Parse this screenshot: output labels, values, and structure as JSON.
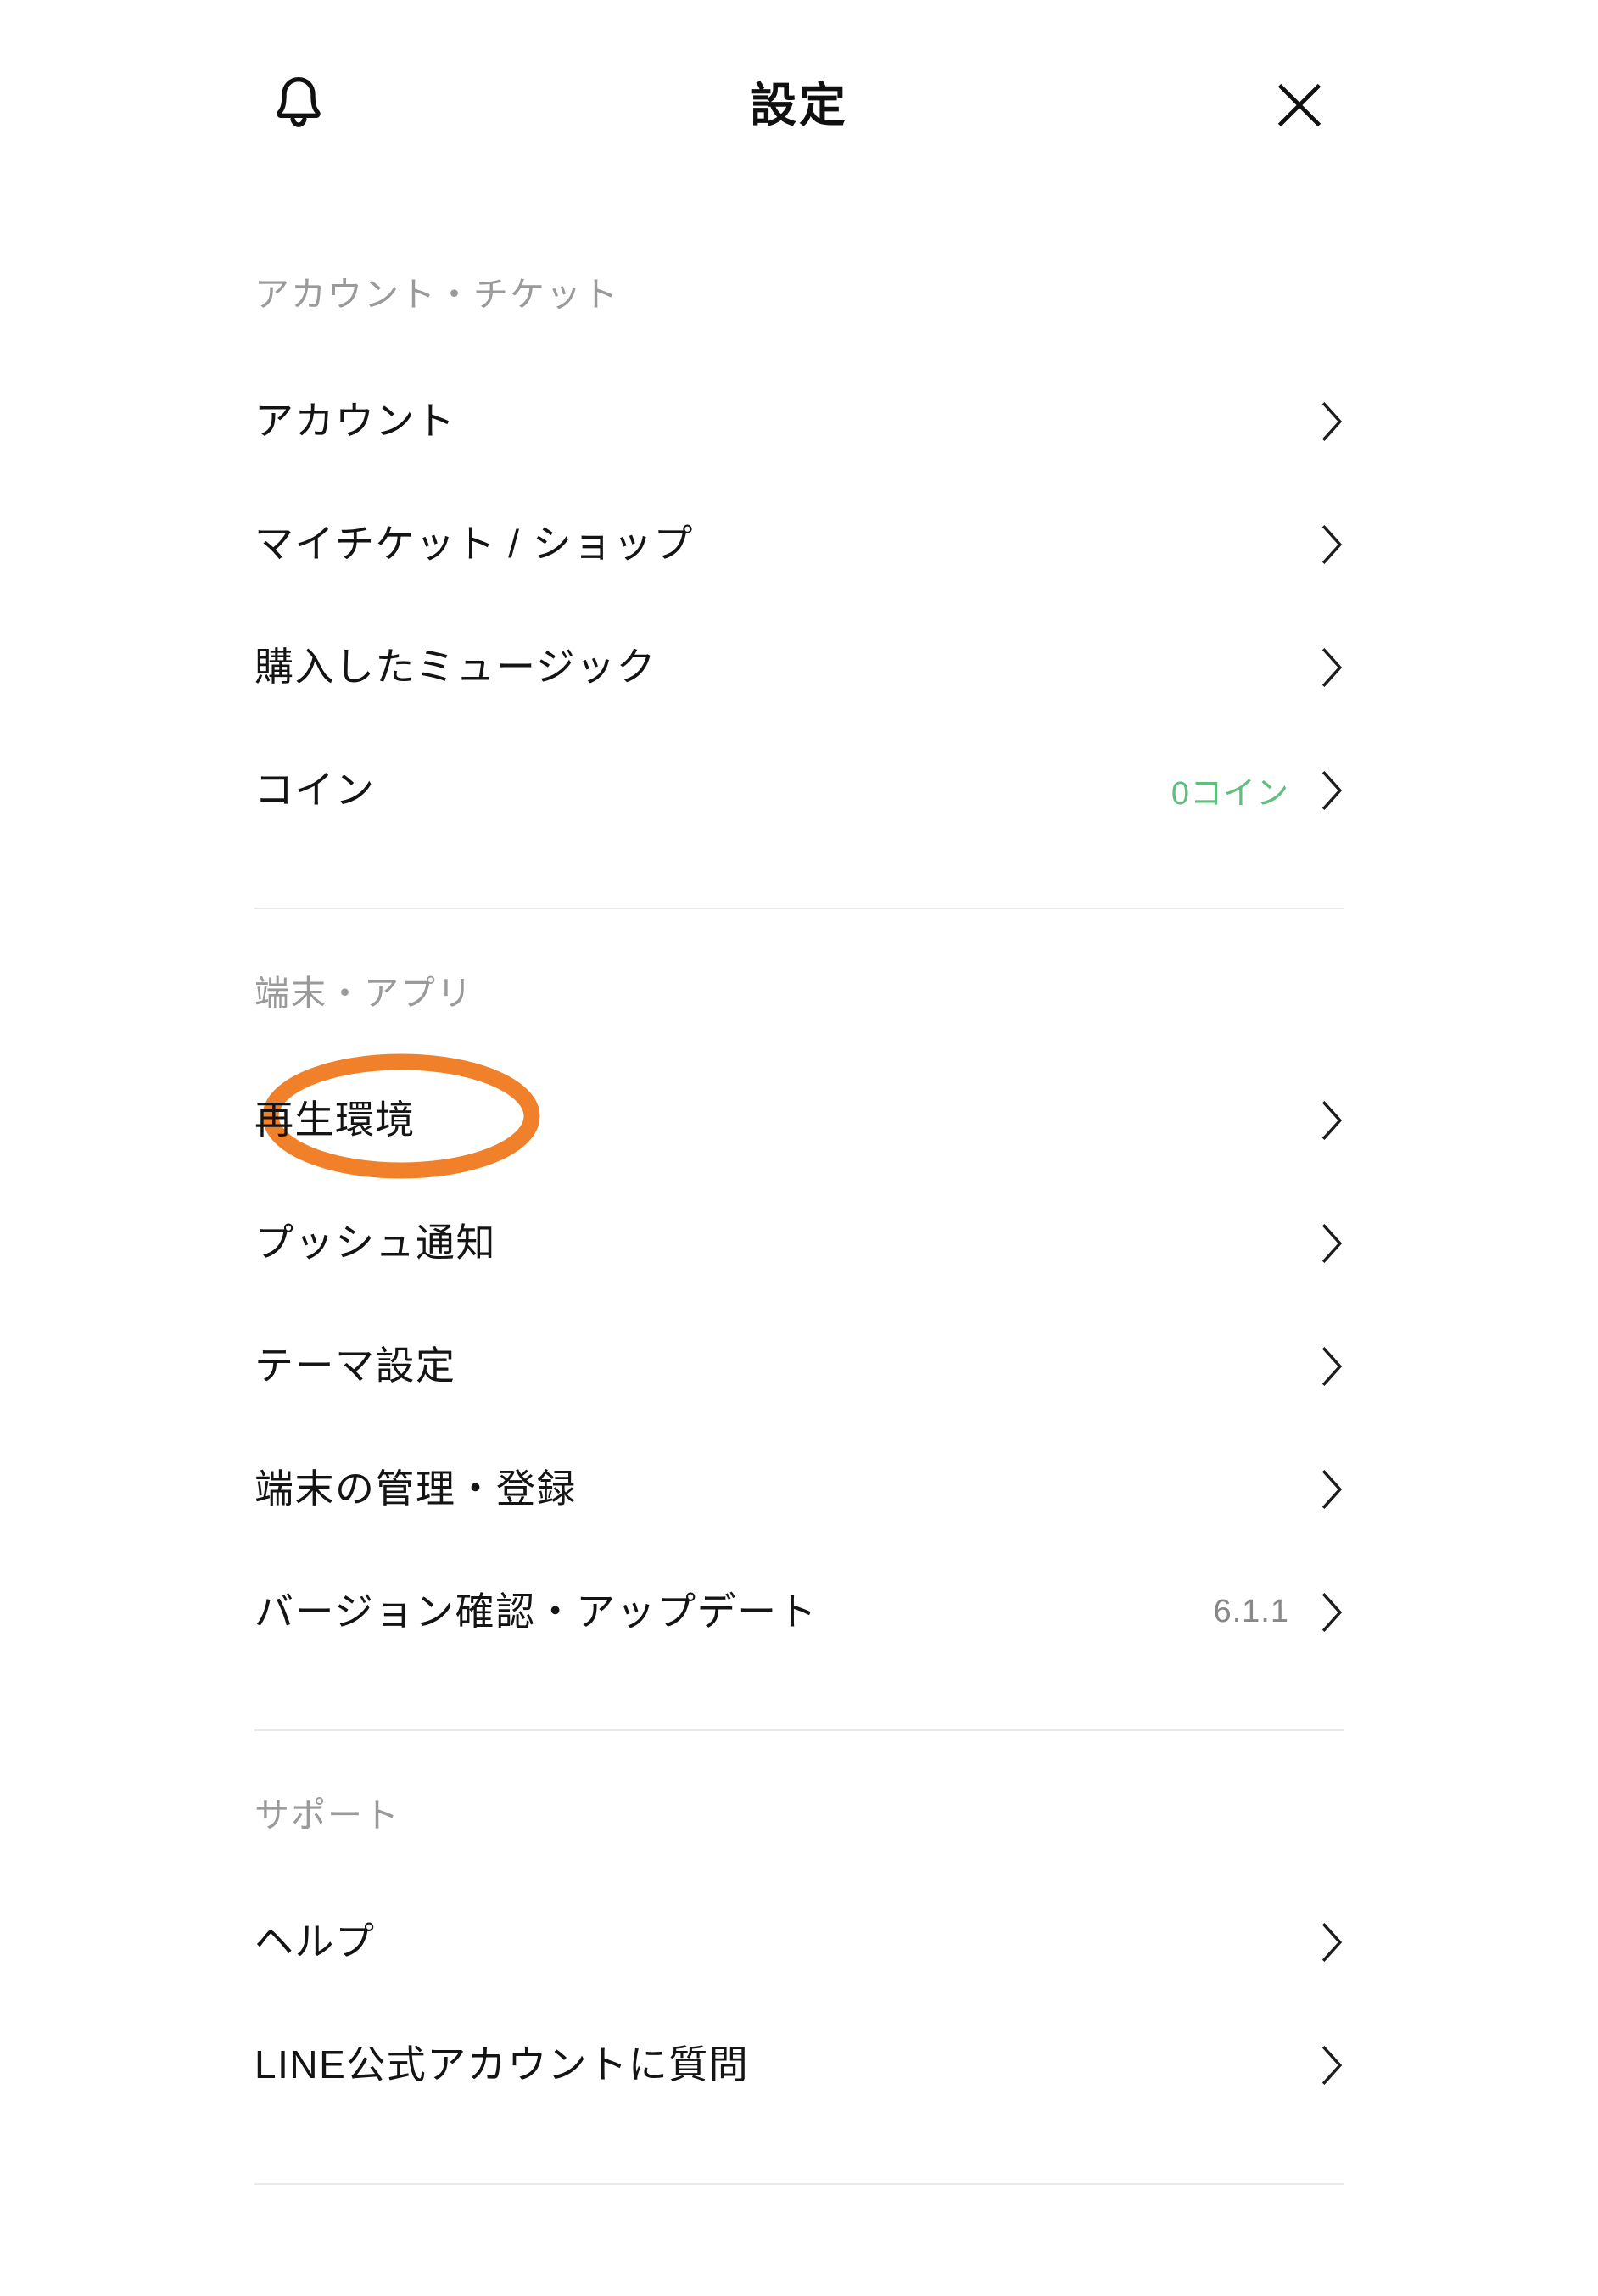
{
  "header": {
    "title": "設定",
    "notification_icon": "bell-icon",
    "close_icon": "close-icon"
  },
  "accent_colors": {
    "coin_green": "#5fbf7d",
    "highlight_orange": "#F0802A",
    "divider_gray": "#e9e9e9",
    "section_title_gray": "#9a9a9a",
    "value_gray": "#888888"
  },
  "sections": [
    {
      "title": "アカウント・チケット",
      "items": [
        {
          "label": "アカウント",
          "value": "",
          "chevron": "chevron-right-icon",
          "highlighted": false
        },
        {
          "label": "マイチケット / ショップ",
          "value": "",
          "chevron": "chevron-right-icon",
          "highlighted": false
        },
        {
          "label": "購入したミュージック",
          "value": "",
          "chevron": "chevron-right-icon",
          "highlighted": false
        },
        {
          "label": "コイン",
          "value": "0コイン",
          "value_accent": true,
          "chevron": "chevron-right-icon",
          "highlighted": false
        }
      ]
    },
    {
      "title": "端末・アプリ",
      "items": [
        {
          "label": "再生環境",
          "value": "",
          "chevron": "chevron-right-icon",
          "highlighted": true
        },
        {
          "label": "プッシュ通知",
          "value": "",
          "chevron": "chevron-right-icon",
          "highlighted": false
        },
        {
          "label": "テーマ設定",
          "value": "",
          "chevron": "chevron-right-icon",
          "highlighted": false
        },
        {
          "label": "端末の管理・登録",
          "value": "",
          "chevron": "chevron-right-icon",
          "highlighted": false
        },
        {
          "label": "バージョン確認・アップデート",
          "value": "6.1.1",
          "value_accent": false,
          "chevron": "chevron-right-icon",
          "highlighted": false
        }
      ]
    },
    {
      "title": "サポート",
      "items": [
        {
          "label": "ヘルプ",
          "value": "",
          "chevron": "chevron-right-icon",
          "highlighted": false
        },
        {
          "label": "LINE公式アカウントに質問",
          "value": "",
          "chevron": "chevron-right-icon",
          "highlighted": false
        }
      ]
    }
  ]
}
